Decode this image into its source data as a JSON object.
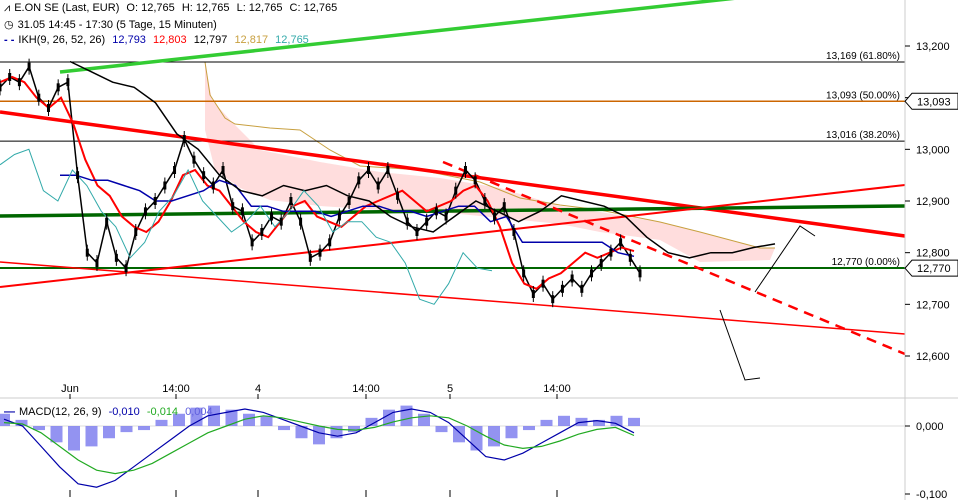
{
  "header": {
    "line1": {
      "symbol": "E.ON SE (Last, EUR)",
      "open": "O: 12,765",
      "high": "H: 12,765",
      "low": "L: 12,765",
      "close": "C: 12,765"
    },
    "line2": "31.05 14:45 - 17:30 (5 Tage, 15 Minuten)",
    "line3": {
      "name": "IKH(9, 26, 52, 26)",
      "v1": "12,793",
      "v2": "12,803",
      "v3": "12,797",
      "v4": "12,817",
      "v5": "12,765"
    },
    "macd": {
      "name": "MACD(12, 26, 9)",
      "v1": "-0,010",
      "v2": "-0,014",
      "v3": "0,004"
    }
  },
  "colors": {
    "price": "#000000",
    "tenkan": "#ff0000",
    "kijun": "#0000aa",
    "chikou": "#33aaaa",
    "senkou_a": "#c8a040",
    "cloud_fill": "#ffdddd",
    "trend_red": "#ff0000",
    "trend_green": "#006600",
    "trend_lime": "#33cc33",
    "fib": "#000000",
    "fib_50": "#cc6600",
    "macd_hist": "#8080ee",
    "macd_line": "#0000aa",
    "signal_line": "#22aa22"
  },
  "chart_data": [
    {
      "type": "line",
      "title": "E.ON SE (Last, EUR)",
      "ylim": [
        12.55,
        13.24
      ],
      "y_ticks": [
        "13,200",
        "13,100",
        "13,000",
        "12,900",
        "12,800",
        "12,700",
        "12,600"
      ],
      "x_ticks": [
        "Jun",
        "14:00",
        "4",
        "14:00",
        "5",
        "14:00"
      ],
      "fib_levels": [
        {
          "label": "13,169 (61.80%)",
          "value": 13.169
        },
        {
          "label": "13,093 (50.00%)",
          "value": 13.093
        },
        {
          "label": "13,016 (38.20%)",
          "value": 13.016
        },
        {
          "label": "12,770 (0.00%)",
          "value": 12.77
        }
      ],
      "price_markers": [
        "13,093",
        "12,770"
      ],
      "series": [
        {
          "values": [
            13.12,
            13.14,
            13.13,
            13.16,
            13.1,
            13.08,
            13.12,
            13.13,
            12.95,
            12.8,
            12.78,
            12.86,
            12.79,
            12.77,
            12.84,
            12.88,
            12.9,
            12.93,
            12.96,
            13.02,
            12.98,
            12.95,
            12.93,
            12.96,
            12.89,
            12.88,
            12.82,
            12.84,
            12.87,
            12.86,
            12.9,
            12.86,
            12.79,
            12.8,
            12.82,
            12.87,
            12.9,
            12.94,
            12.96,
            12.93,
            12.96,
            12.91,
            12.86,
            12.84,
            12.86,
            12.88,
            12.87,
            12.92,
            12.96,
            12.94,
            12.9,
            12.87,
            12.89,
            12.84,
            12.76,
            12.72,
            12.74,
            12.71,
            12.73,
            12.75,
            12.73,
            12.76,
            12.78,
            12.8,
            12.82,
            12.79,
            12.76
          ]
        },
        {
          "values": [
            13.13,
            13.14,
            13.13,
            13.1,
            13.08,
            13.1,
            13.05,
            12.98,
            12.93,
            12.91,
            12.87,
            12.85,
            12.84,
            12.86,
            12.9,
            12.95,
            12.96,
            12.93,
            12.92,
            12.89,
            12.86,
            12.84,
            12.83,
            12.86,
            12.89,
            12.9,
            12.87,
            12.86,
            12.85,
            12.87,
            12.89,
            12.9,
            12.91,
            12.92,
            12.9,
            12.88,
            12.89,
            12.9,
            12.92,
            12.93,
            12.9,
            12.85,
            12.78,
            12.74,
            12.73,
            12.75,
            12.76,
            12.78,
            12.8,
            12.79,
            12.8,
            12.81,
            12.803
          ]
        },
        {
          "values": [
            12.95,
            12.95,
            12.94,
            12.94,
            12.93,
            12.92,
            12.9,
            12.9,
            12.91,
            12.92,
            12.94,
            12.93,
            12.89,
            12.89,
            12.88,
            12.88,
            12.88,
            12.87,
            12.88,
            12.89,
            12.89,
            12.88,
            12.88,
            12.87,
            12.88,
            12.89,
            12.89,
            12.86,
            12.87,
            12.82,
            12.82,
            12.82,
            12.82,
            12.82,
            12.82,
            12.8,
            12.793
          ]
        },
        {
          "values": [
            13.17,
            13.15,
            13.13,
            13.12,
            13.09,
            13.03,
            13.0,
            12.95,
            12.92,
            12.91,
            12.93,
            12.92,
            12.93,
            12.91,
            12.9,
            12.87,
            12.85,
            12.84,
            12.87,
            12.9,
            12.88,
            12.86,
            12.88,
            12.91,
            12.9,
            12.89,
            12.87,
            12.83,
            12.8,
            12.79,
            12.8,
            12.8,
            12.81,
            12.817
          ]
        },
        {
          "values": [
            12.97,
            12.99,
            13.0,
            12.92,
            12.9,
            12.96,
            12.93,
            12.88,
            12.85,
            12.79,
            12.82,
            12.88,
            12.91,
            12.96,
            12.9,
            12.87,
            12.84,
            12.86,
            12.89,
            12.85,
            12.88,
            12.92,
            12.89,
            12.84,
            12.86,
            12.86,
            12.83,
            12.82,
            12.78,
            12.71,
            12.7,
            12.74,
            12.8,
            12.77,
            12.765
          ]
        }
      ]
    },
    {
      "type": "bar",
      "title": "MACD(12, 26, 9)",
      "y_ticks": [
        "0,000",
        "-0,100"
      ],
      "ylim": [
        -0.13,
        0.06
      ],
      "histogram": [
        0.006,
        0.003,
        -0.002,
        -0.008,
        -0.012,
        -0.01,
        -0.006,
        -0.003,
        -0.002,
        0.003,
        0.006,
        0.009,
        0.01,
        0.008,
        0.006,
        0.005,
        -0.002,
        -0.006,
        -0.009,
        -0.006,
        -0.003,
        0.004,
        0.008,
        0.01,
        0.006,
        -0.003,
        -0.008,
        -0.012,
        -0.01,
        -0.006,
        -0.002,
        0.003,
        0.005,
        0.004,
        0.003,
        0.005,
        0.004
      ],
      "series": [
        {
          "values": [
            0.01,
            0.0,
            -0.03,
            -0.06,
            -0.085,
            -0.09,
            -0.08,
            -0.06,
            -0.04,
            -0.02,
            0.0,
            0.015,
            0.02,
            0.025,
            0.02,
            0.01,
            0.0,
            -0.01,
            -0.015,
            -0.01,
            0.005,
            0.02,
            0.025,
            0.02,
            0.005,
            -0.02,
            -0.045,
            -0.05,
            -0.04,
            -0.025,
            -0.01,
            0.005,
            0.008,
            0.004,
            -0.01
          ]
        },
        {
          "values": [
            0.005,
            0.003,
            -0.01,
            -0.03,
            -0.05,
            -0.065,
            -0.07,
            -0.065,
            -0.055,
            -0.04,
            -0.025,
            -0.01,
            0.0,
            0.01,
            0.015,
            0.012,
            0.006,
            0.0,
            -0.005,
            -0.006,
            -0.002,
            0.006,
            0.012,
            0.015,
            0.012,
            0.0,
            -0.015,
            -0.028,
            -0.033,
            -0.03,
            -0.022,
            -0.012,
            -0.005,
            -0.002,
            -0.014
          ]
        }
      ]
    }
  ]
}
